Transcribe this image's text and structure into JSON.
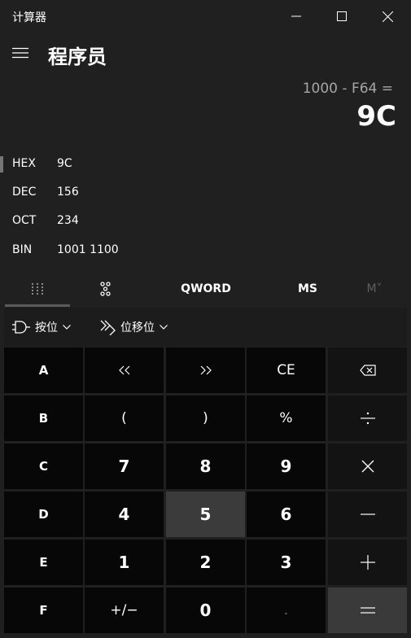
{
  "window": {
    "title": "计算器"
  },
  "header": {
    "mode_title": "程序员"
  },
  "display": {
    "expression": "1000 - F64 =",
    "result": "9C"
  },
  "radix": [
    {
      "name": "HEX",
      "value": "9C"
    },
    {
      "name": "DEC",
      "value": "156"
    },
    {
      "name": "OCT",
      "value": "234"
    },
    {
      "name": "BIN",
      "value": "1001 1100"
    }
  ],
  "pivot": {
    "word_size": "QWORD",
    "memory_store": "MS",
    "memory_recall": "M˅"
  },
  "bitwise": {
    "bitwise_label": "按位",
    "shift_label": "位移位"
  },
  "keys": [
    [
      "A",
      "<<",
      ">>",
      "CE",
      "⌫"
    ],
    [
      "B",
      "(",
      ")",
      "%",
      "÷"
    ],
    [
      "C",
      "7",
      "8",
      "9",
      "×"
    ],
    [
      "D",
      "4",
      "5",
      "6",
      "−"
    ],
    [
      "E",
      "1",
      "2",
      "3",
      "+"
    ],
    [
      "F",
      "+/−",
      "0",
      ".",
      "="
    ]
  ],
  "icons": {
    "minimize": "minimize-icon",
    "maximize": "maximize-icon",
    "close": "close-icon",
    "menu": "hamburger-menu-icon",
    "full_keypad": "full-keypad-icon",
    "bit_toggle": "bit-toggle-keypad-icon",
    "logic_gate": "logic-gate-icon",
    "bit_shift": "bit-shift-icon",
    "backspace": "backspace-icon"
  }
}
